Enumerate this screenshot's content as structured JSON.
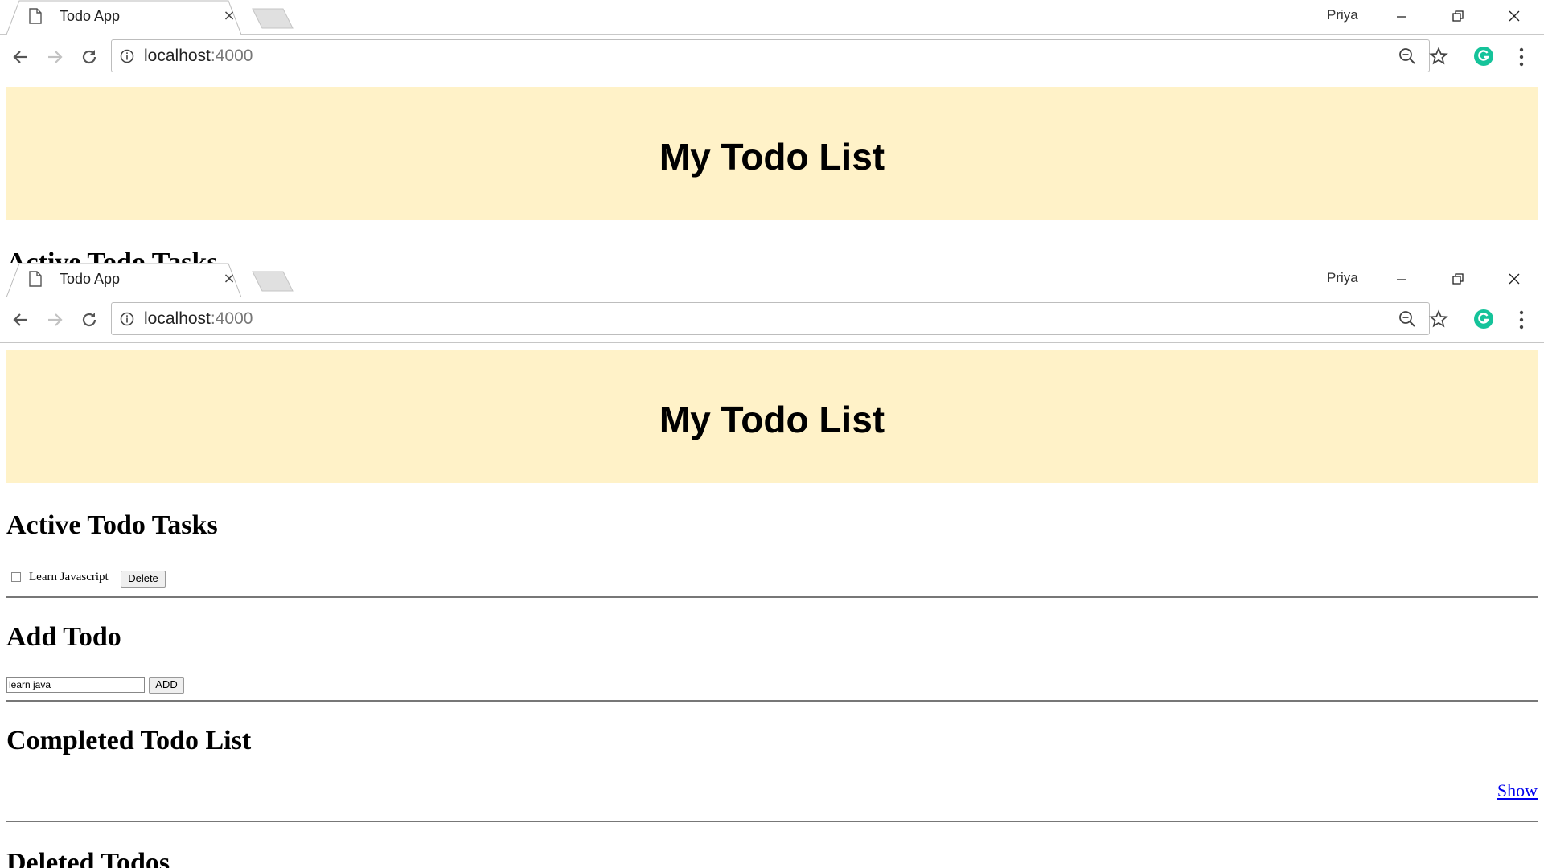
{
  "browser": {
    "tab_title": "Todo App",
    "tab_close": "×",
    "profile_name": "Priya",
    "url_host": "localhost",
    "url_port": ":4000"
  },
  "icons": {
    "tab": "page-icon",
    "new_tab": "new-tab-icon",
    "minimize": "minimize-icon",
    "maximize": "restore-icon",
    "close": "close-icon",
    "back": "back-arrow-icon",
    "forward": "forward-arrow-icon",
    "reload": "reload-icon",
    "info": "info-icon",
    "zoom": "zoom-out-icon",
    "bookmark": "star-icon",
    "extension": "grammarly-icon",
    "menu": "kebab-menu-icon"
  },
  "page": {
    "title": "My Todo List",
    "active_heading": "Active Todo Tasks",
    "active_tasks": [
      {
        "label": "Learn Javascript",
        "checked": false,
        "delete_label": "Delete"
      }
    ],
    "add_heading": "Add Todo",
    "add_input_value": "learn java",
    "add_button": "ADD",
    "completed_heading": "Completed Todo List",
    "show_link": "Show",
    "deleted_heading": "Deleted Todos"
  },
  "colors": {
    "banner": "#fff2c8",
    "link": "#0000ee",
    "grammarly": "#15c39a"
  }
}
